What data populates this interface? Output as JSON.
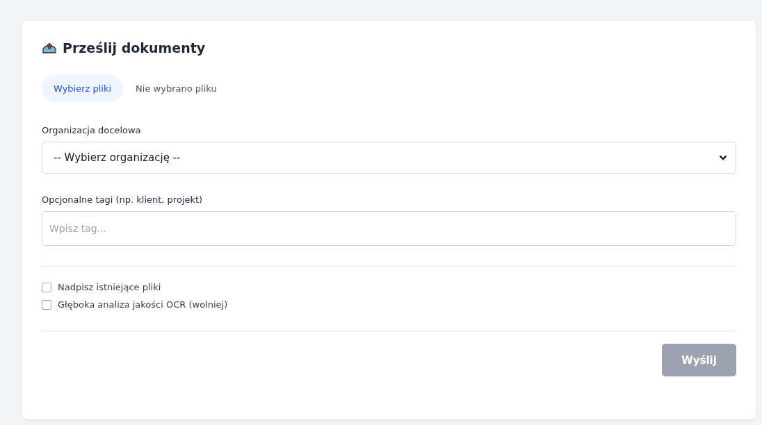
{
  "card": {
    "title": "Prześlij dokumenty"
  },
  "file_picker": {
    "button": "Wybierz pliki",
    "status": "Nie wybrano pliku"
  },
  "organization": {
    "label": "Organizacja docelowa",
    "value": "-- Wybierz organizację --"
  },
  "tags": {
    "label": "Opcjonalne tagi (np. klient, projekt)",
    "placeholder": "Wpisz tag..."
  },
  "options": [
    {
      "label": "Nadpisz istniejące pliki",
      "checked": false
    },
    {
      "label": "Głęboka analiza jakości OCR (wolniej)",
      "checked": false
    }
  ],
  "submit": {
    "label": "Wyślij",
    "disabled": true
  }
}
